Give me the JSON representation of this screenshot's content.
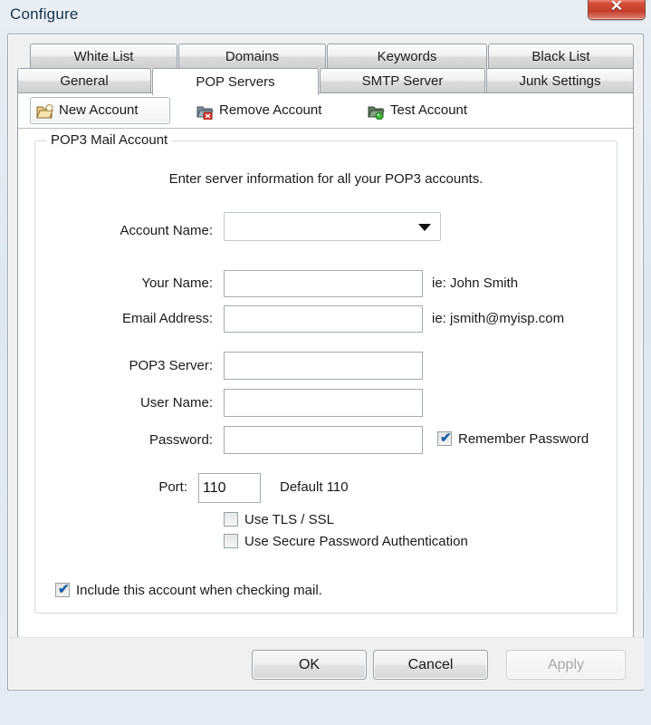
{
  "window": {
    "title": "Configure",
    "close_label": "✕",
    "close_icon": "close-icon"
  },
  "tabs": {
    "top_row": [
      {
        "label": "White List",
        "selected": false
      },
      {
        "label": "Domains",
        "selected": false
      },
      {
        "label": "Keywords",
        "selected": false
      },
      {
        "label": "Black List",
        "selected": false
      }
    ],
    "bottom_row": [
      {
        "label": "General",
        "selected": false
      },
      {
        "label": "POP Servers",
        "selected": true
      },
      {
        "label": "SMTP Server",
        "selected": false
      },
      {
        "label": "Junk Settings",
        "selected": false
      }
    ]
  },
  "toolbar": {
    "new_account": "New Account",
    "remove_account": "Remove Account",
    "test_account": "Test Account",
    "new_account_icon": "folder-new-icon",
    "remove_account_icon": "folder-delete-icon",
    "test_account_icon": "folder-check-icon"
  },
  "group": {
    "legend": "POP3 Mail Account",
    "intro": "Enter server information for all your POP3 accounts."
  },
  "form": {
    "account_name_label": "Account Name:",
    "account_name_value": "",
    "your_name_label": "Your Name:",
    "your_name_value": "",
    "your_name_hint": "ie: John Smith",
    "email_label": "Email Address:",
    "email_value": "",
    "email_hint": "ie: jsmith@myisp.com",
    "pop3_label": "POP3 Server:",
    "pop3_value": "",
    "user_label": "User Name:",
    "user_value": "",
    "password_label": "Password:",
    "password_value": "",
    "port_label": "Port:",
    "port_value": "110",
    "port_hint": "Default 110"
  },
  "checkboxes": {
    "remember_password": {
      "label": "Remember Password",
      "checked": true,
      "mark": "✔"
    },
    "use_tls_ssl": {
      "label": "Use TLS / SSL",
      "checked": false,
      "mark": ""
    },
    "use_spa": {
      "label": "Use Secure Password Authentication",
      "checked": false,
      "mark": ""
    },
    "include_account": {
      "label": "Include this account when checking mail.",
      "checked": true,
      "mark": "✔"
    }
  },
  "buttons": {
    "ok": "OK",
    "cancel": "Cancel",
    "apply": "Apply"
  },
  "colors": {
    "titlebar_text": "#16344d",
    "close_red": "#d6503c",
    "check_blue": "#1d5ea8",
    "panel": "#f0f0f0"
  }
}
